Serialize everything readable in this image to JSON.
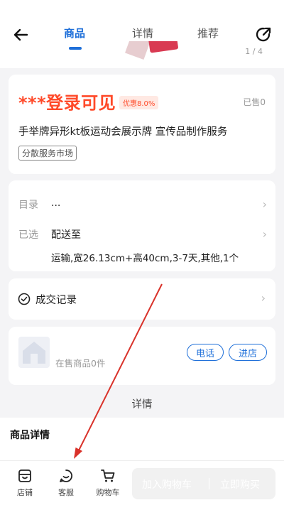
{
  "header": {
    "tabs": [
      "商品",
      "详情",
      "推荐"
    ],
    "active_tab": "商品",
    "page_indicator": "1 / 4"
  },
  "product": {
    "price": "***登录可见",
    "discount": "优惠8.0%",
    "sold": "已售0",
    "title": "手举牌异形kt板运动会展示牌 宣传品制作服务",
    "tag": "分散服务市场"
  },
  "options": {
    "catalog_label": "目录",
    "catalog_value": "...",
    "selected_label": "已选",
    "selected_value": "配送至",
    "selected_detail": "运输,宽26.13cm+高40cm,3-7天,其他,1个"
  },
  "transactions": {
    "label": "成交记录"
  },
  "shop": {
    "count": "在售商品0件",
    "call_label": "电话",
    "enter_label": "进店"
  },
  "section_heading": "详情",
  "detail": {
    "title": "商品详情"
  },
  "bottom_nav": {
    "store": "店铺",
    "service": "客服",
    "cart": "购物车",
    "add_to_cart": "加入购物车",
    "buy_now": "立即购买"
  },
  "colors": {
    "accent": "#1e6fd9",
    "price": "#ff4a2a",
    "annotation": "#d9322a"
  }
}
